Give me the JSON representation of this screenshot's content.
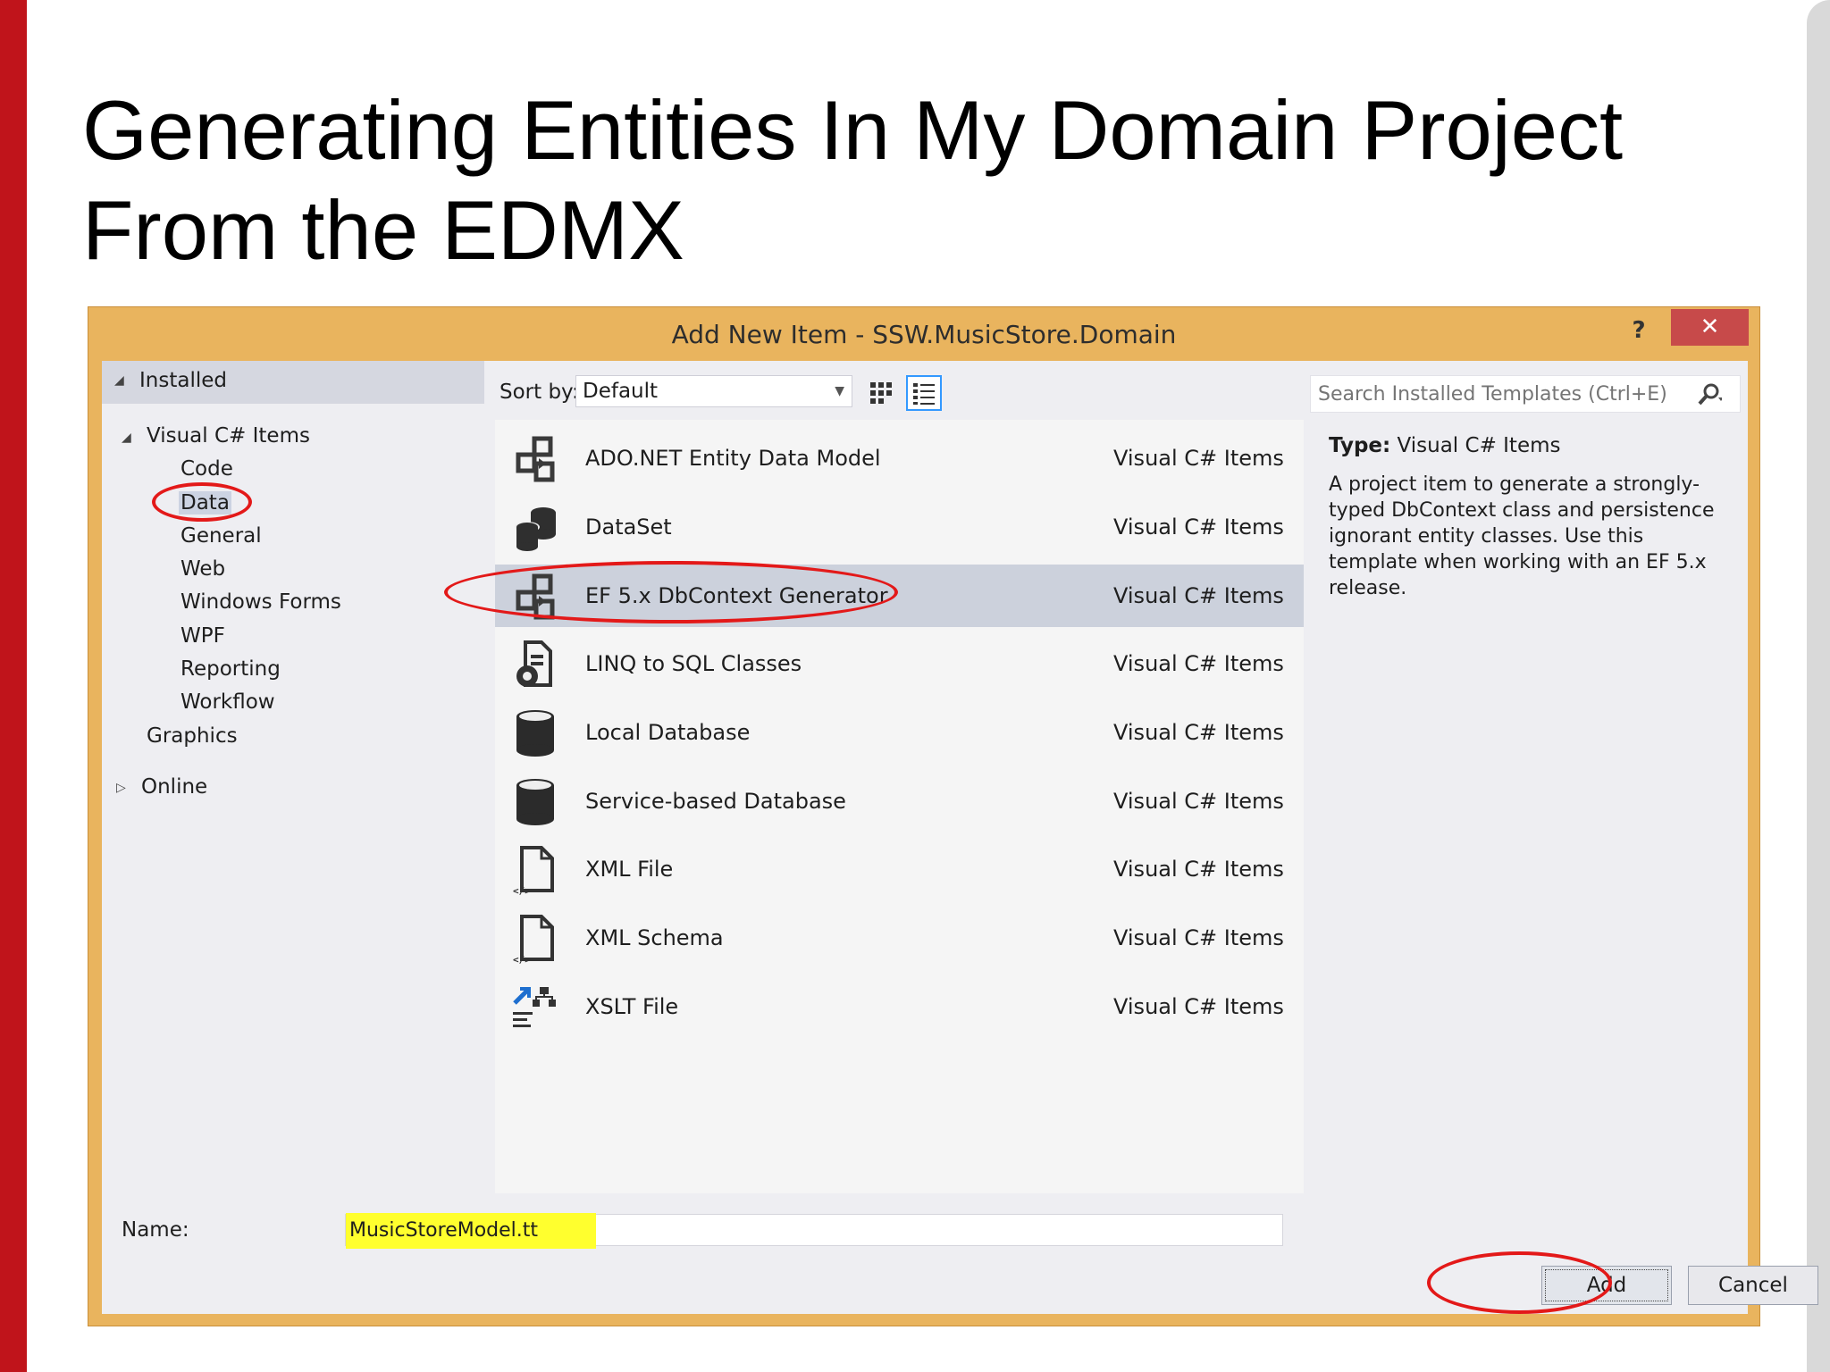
{
  "slide": {
    "title_line1": "Generating Entities In My Domain Project",
    "title_line2": "From the EDMX"
  },
  "dialog": {
    "title": "Add New Item - SSW.MusicStore.Domain",
    "help_label": "?",
    "close_label": "✕"
  },
  "tree": {
    "installed": "Installed",
    "visual_csharp": "Visual C# Items",
    "children": [
      "Code",
      "Data",
      "General",
      "Web",
      "Windows Forms",
      "WPF",
      "Reporting",
      "Workflow"
    ],
    "selected": "Data",
    "graphics": "Graphics",
    "online": "Online"
  },
  "toolbar": {
    "sort_label": "Sort by:",
    "sort_value": "Default"
  },
  "items": [
    {
      "name": "ADO.NET Entity Data Model",
      "category": "Visual C# Items",
      "icon": "entity-model-icon"
    },
    {
      "name": "DataSet",
      "category": "Visual C# Items",
      "icon": "dataset-icon"
    },
    {
      "name": "EF 5.x DbContext Generator",
      "category": "Visual C# Items",
      "icon": "entity-model-icon",
      "selected": true
    },
    {
      "name": "LINQ to SQL Classes",
      "category": "Visual C# Items",
      "icon": "linq-icon"
    },
    {
      "name": "Local Database",
      "category": "Visual C# Items",
      "icon": "database-icon"
    },
    {
      "name": "Service-based Database",
      "category": "Visual C# Items",
      "icon": "database-icon"
    },
    {
      "name": "XML File",
      "category": "Visual C# Items",
      "icon": "xml-file-icon"
    },
    {
      "name": "XML Schema",
      "category": "Visual C# Items",
      "icon": "xml-file-icon"
    },
    {
      "name": "XSLT File",
      "category": "Visual C# Items",
      "icon": "xslt-icon"
    }
  ],
  "details": {
    "search_placeholder": "Search Installed Templates (Ctrl+E)",
    "type_label": "Type:",
    "type_value": "Visual C# Items",
    "description": "A project item to generate a strongly-typed DbContext class and persistence ignorant entity classes. Use this template when working with an EF 5.x release."
  },
  "name_field": {
    "label": "Name:",
    "value": "MusicStoreModel.tt"
  },
  "buttons": {
    "add": "Add",
    "cancel": "Cancel"
  },
  "colors": {
    "accent_red": "#c0141b",
    "dialog_frame": "#e9b45e",
    "annotation": "#e31919",
    "highlight": "#ffff2e"
  }
}
